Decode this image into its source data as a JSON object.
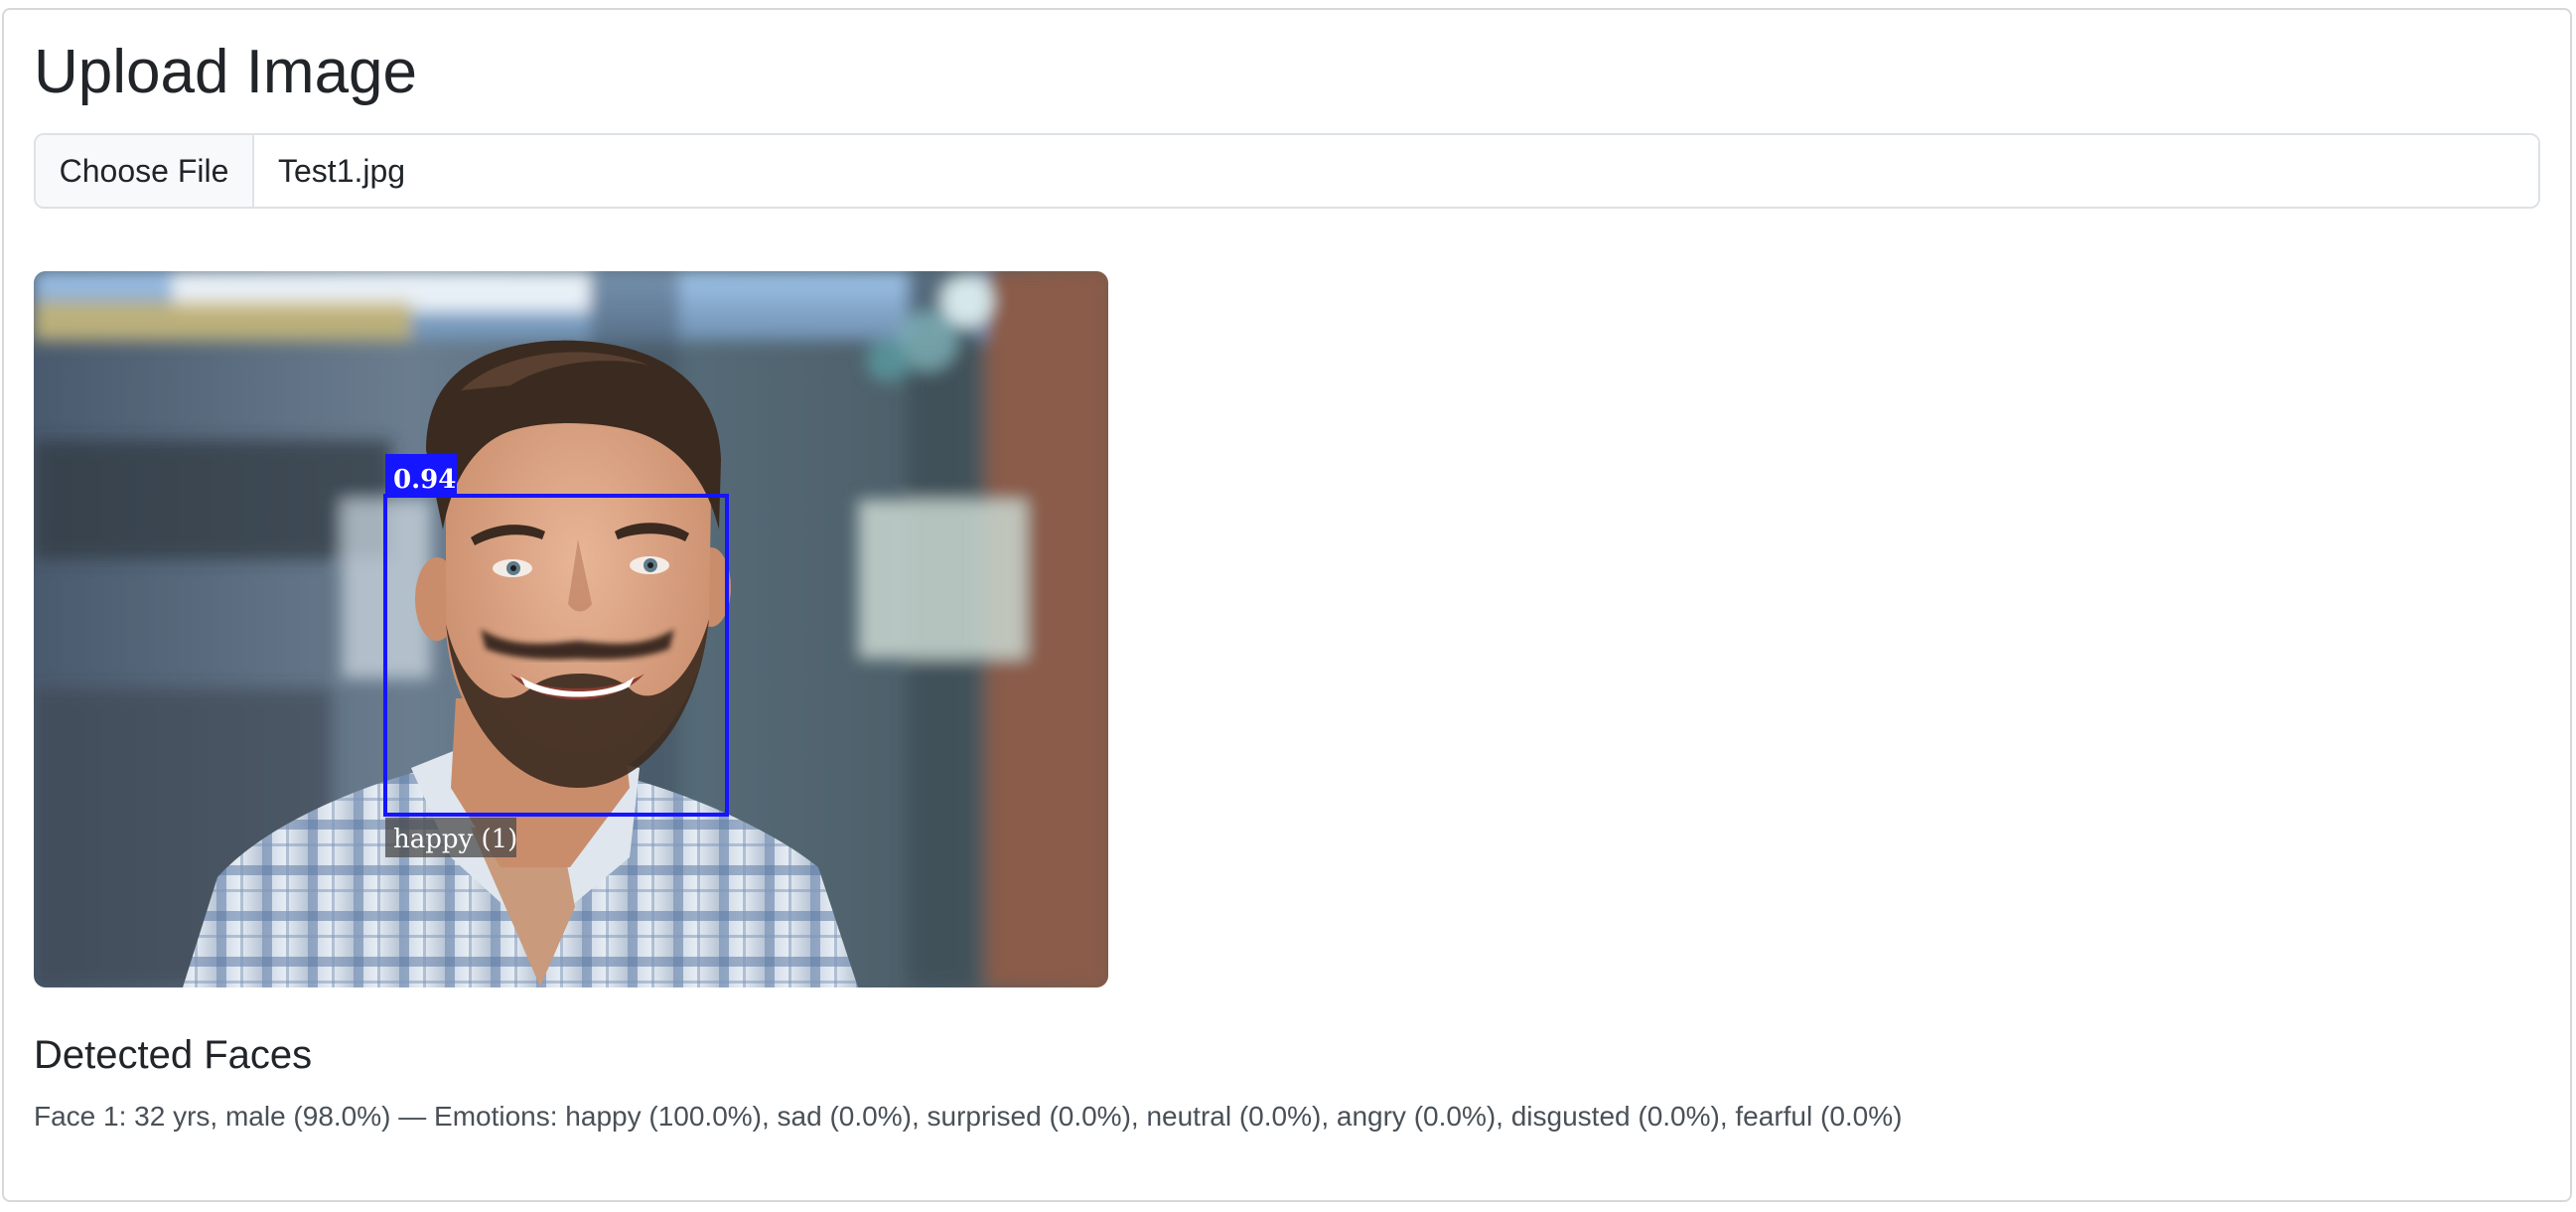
{
  "page": {
    "title": "Upload Image"
  },
  "upload": {
    "choose_label": "Choose File",
    "file_name": "Test1.jpg"
  },
  "detection": {
    "score_label": "0.94",
    "expression_label": "happy (1)",
    "box_color": "#1515ff"
  },
  "results": {
    "heading": "Detected Faces",
    "faces": [
      "Face 1: 32 yrs, male (98.0%) — Emotions: happy (100.0%), sad (0.0%), surprised (0.0%), neutral (0.0%), angry (0.0%), disgusted (0.0%), fearful (0.0%)"
    ]
  }
}
